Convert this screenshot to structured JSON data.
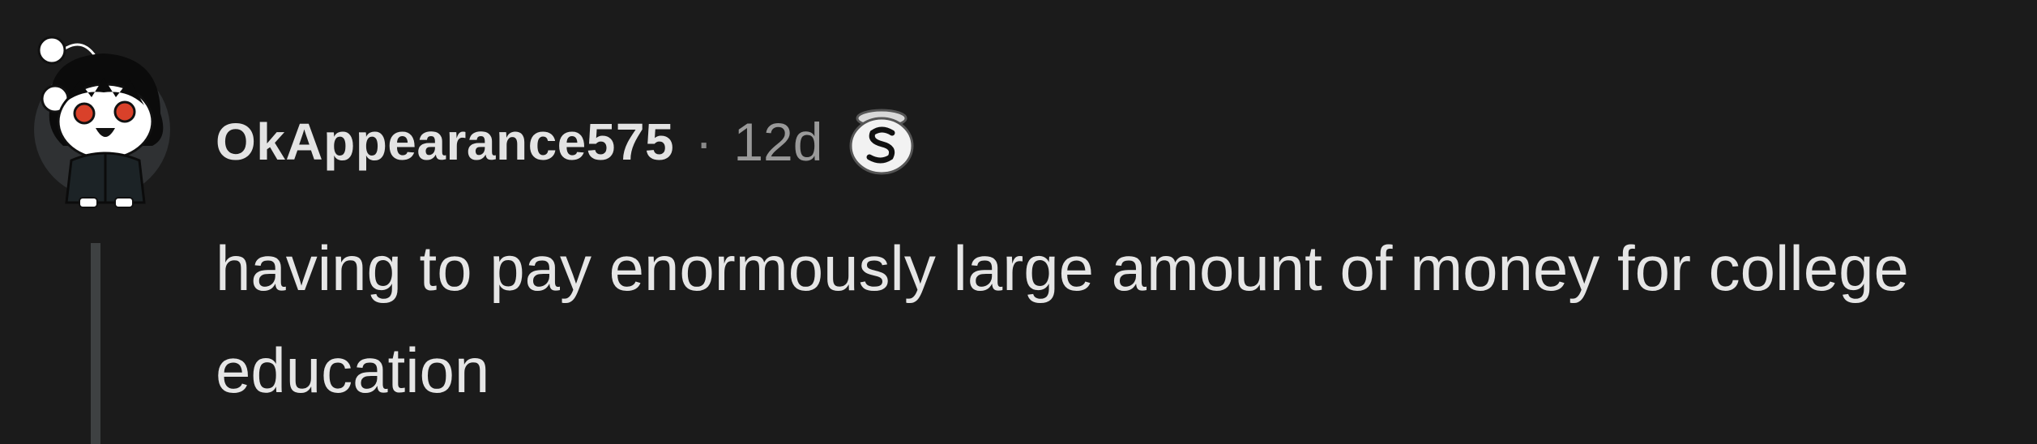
{
  "comment": {
    "username": "OkAppearance575",
    "separator": "·",
    "age": "12d",
    "avatar_icon": "snoo-avatar-icon",
    "flair_icon": "s-badge-icon",
    "body": "having to pay enormously large amount of money for college education"
  },
  "colors": {
    "background": "#1b1b1b",
    "username": "#e3e3e3",
    "meta": "#9a9a9a",
    "body": "#e6e6e6",
    "thread_line": "#3e4142",
    "avatar_eyes": "#d9412a"
  }
}
